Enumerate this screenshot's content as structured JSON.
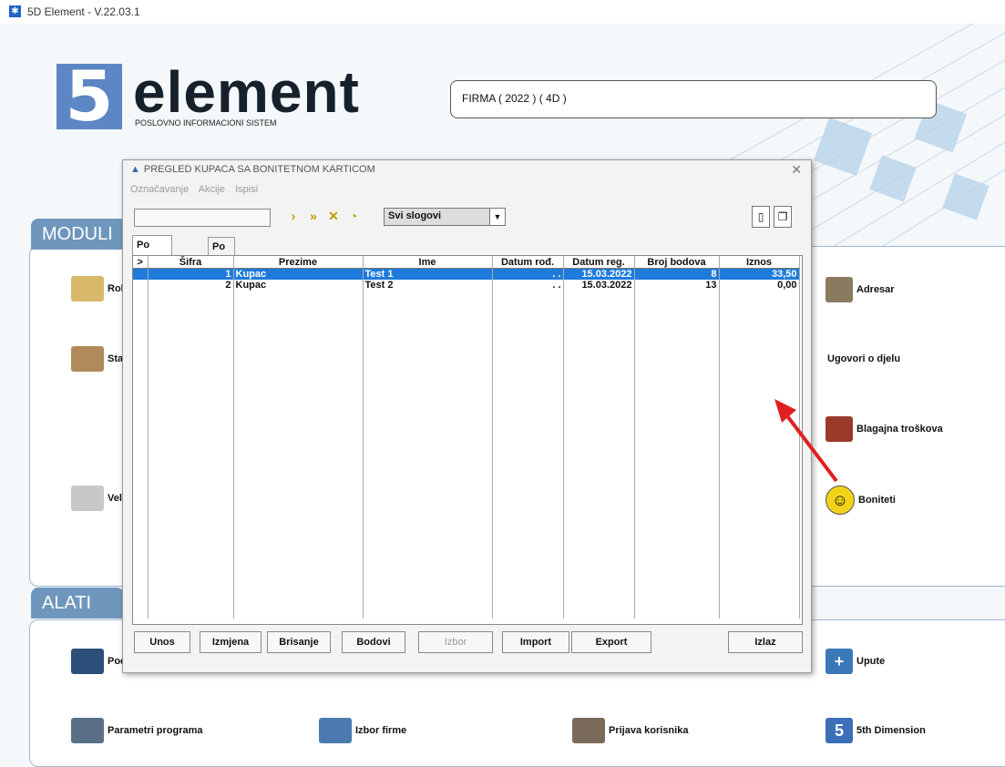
{
  "app": {
    "title": "5D Element - V.22.03.1",
    "logo_word": "element",
    "logo_sub": "POSLOVNO INFORMACIONI SISTEM",
    "firm": "FIRMA  ( 2022 ) ( 4D )"
  },
  "sections": {
    "moduli": "MODULI",
    "alati": "ALATI"
  },
  "modules": [
    {
      "label": "Rob",
      "icon": "boxes-icon"
    },
    {
      "label": "Stal",
      "icon": "stock-icon"
    },
    {
      "label": "Vele",
      "icon": "hex-icon"
    },
    {
      "label": "Adresar",
      "icon": "pen-icon"
    },
    {
      "label": "Ugovori o djelu",
      "icon": ""
    },
    {
      "label": "Blagajna troškova",
      "icon": "cashbox-icon"
    },
    {
      "label": "Boniteti",
      "icon": "smiley-icon"
    }
  ],
  "tools": [
    {
      "label": "Pod",
      "icon": "monitor-icon"
    },
    {
      "label": "Upute",
      "icon": "help-icon"
    },
    {
      "label": "Parametri programa",
      "icon": "gears-icon"
    },
    {
      "label": "Izbor firme",
      "icon": "firm-icon"
    },
    {
      "label": "Prijava korisnika",
      "icon": "users-icon"
    },
    {
      "label": "5th Dimension",
      "icon": "logo-icon"
    }
  ],
  "dialog": {
    "title": "PREGLED KUPACA SA BONITETNOM KARTICOM",
    "menu": [
      "Označavanje",
      "Akcije",
      "Ispisi"
    ],
    "select_value": "Svi slogovi",
    "tabs": [
      "Po nazivu",
      "Po šifri"
    ],
    "columns": [
      ">",
      "Šifra",
      "Prezime",
      "Ime",
      "Datum rođ.",
      "Datum reg.",
      "Broj bodova",
      "Iznos"
    ],
    "rows": [
      {
        "marker": "",
        "sifra": "1",
        "prezime": "Kupac",
        "ime": "Test 1",
        "datum_rod": ". .",
        "datum_reg": "15.03.2022",
        "bodovi": "8",
        "iznos": "33,50",
        "selected": true
      },
      {
        "marker": "",
        "sifra": "2",
        "prezime": "Kupac",
        "ime": "Test 2",
        "datum_rod": ". .",
        "datum_reg": "15.03.2022",
        "bodovi": "13",
        "iznos": "0,00",
        "selected": false
      }
    ],
    "buttons": {
      "unos": "Unos",
      "izmjena": "Izmjena",
      "brisanje": "Brisanje",
      "bodovi": "Bodovi",
      "izbor": "Izbor",
      "import": "Import",
      "export": "Export",
      "izlaz": "Izlaz"
    }
  },
  "colors": {
    "selection": "#1e7bdc",
    "section_tab": "#6f97bd",
    "logo_blue": "#5d86c4",
    "arrow": "#e02020"
  }
}
